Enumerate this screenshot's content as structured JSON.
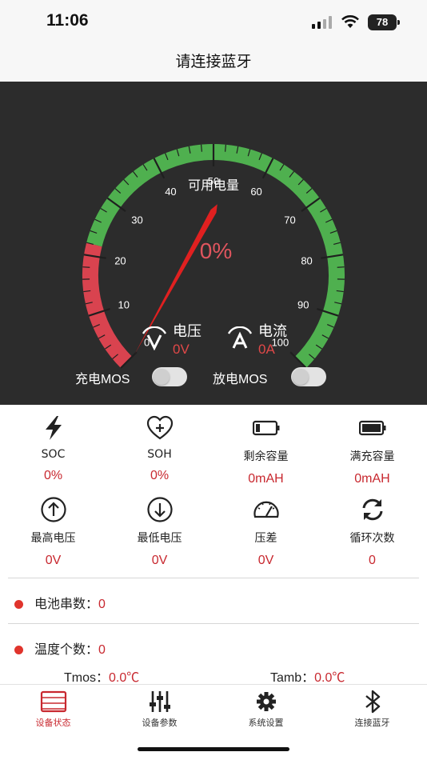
{
  "status_bar": {
    "time": "11:06",
    "battery": "78"
  },
  "nav": {
    "title": "请连接蓝牙"
  },
  "gauge": {
    "label": "可用电量",
    "value": "0%",
    "ticks": [
      "0",
      "10",
      "20",
      "30",
      "40",
      "50",
      "60",
      "70",
      "80",
      "90",
      "100"
    ],
    "level": 0,
    "colors": {
      "red": "#d9434f",
      "green": "#4fb04f",
      "needle": "#e02020"
    }
  },
  "meters": {
    "voltage": {
      "title": "电压",
      "value": "0V",
      "icon": "voltage-icon"
    },
    "current": {
      "title": "电流",
      "value": "0A",
      "icon": "current-icon"
    }
  },
  "mos": {
    "charge_label": "充电MOS",
    "discharge_label": "放电MOS",
    "charge_on": false,
    "discharge_on": false
  },
  "stats": [
    {
      "label": "SOC",
      "value": "0%",
      "icon": "lightning-icon"
    },
    {
      "label": "SOH",
      "value": "0%",
      "icon": "heart-plus-icon"
    },
    {
      "label": "剩余容量",
      "value": "0mAH",
      "icon": "battery-low-icon"
    },
    {
      "label": "满充容量",
      "value": "0mAH",
      "icon": "battery-full-icon"
    },
    {
      "label": "最高电压",
      "value": "0V",
      "icon": "arrow-up-circle-icon"
    },
    {
      "label": "最低电压",
      "value": "0V",
      "icon": "arrow-down-circle-icon"
    },
    {
      "label": "压差",
      "value": "0V",
      "icon": "speedometer-icon"
    },
    {
      "label": "循环次数",
      "value": "0",
      "icon": "refresh-icon"
    }
  ],
  "info": {
    "cell_count": {
      "label": "电池串数：",
      "value": "0"
    },
    "temp_count": {
      "label": "温度个数：",
      "value": "0"
    },
    "tmos": {
      "label": "Tmos：",
      "value": "0.0℃"
    },
    "tamb": {
      "label": "Tamb：",
      "value": "0.0℃"
    }
  },
  "tabs": [
    {
      "label": "设备状态",
      "icon": "list-icon",
      "active": true
    },
    {
      "label": "设备参数",
      "icon": "sliders-icon",
      "active": false
    },
    {
      "label": "系统设置",
      "icon": "gear-icon",
      "active": false
    },
    {
      "label": "连接蓝牙",
      "icon": "bluetooth-icon",
      "active": false
    }
  ],
  "colors": {
    "accent": "#c8282f",
    "dark_bg": "#2c2c2c"
  }
}
